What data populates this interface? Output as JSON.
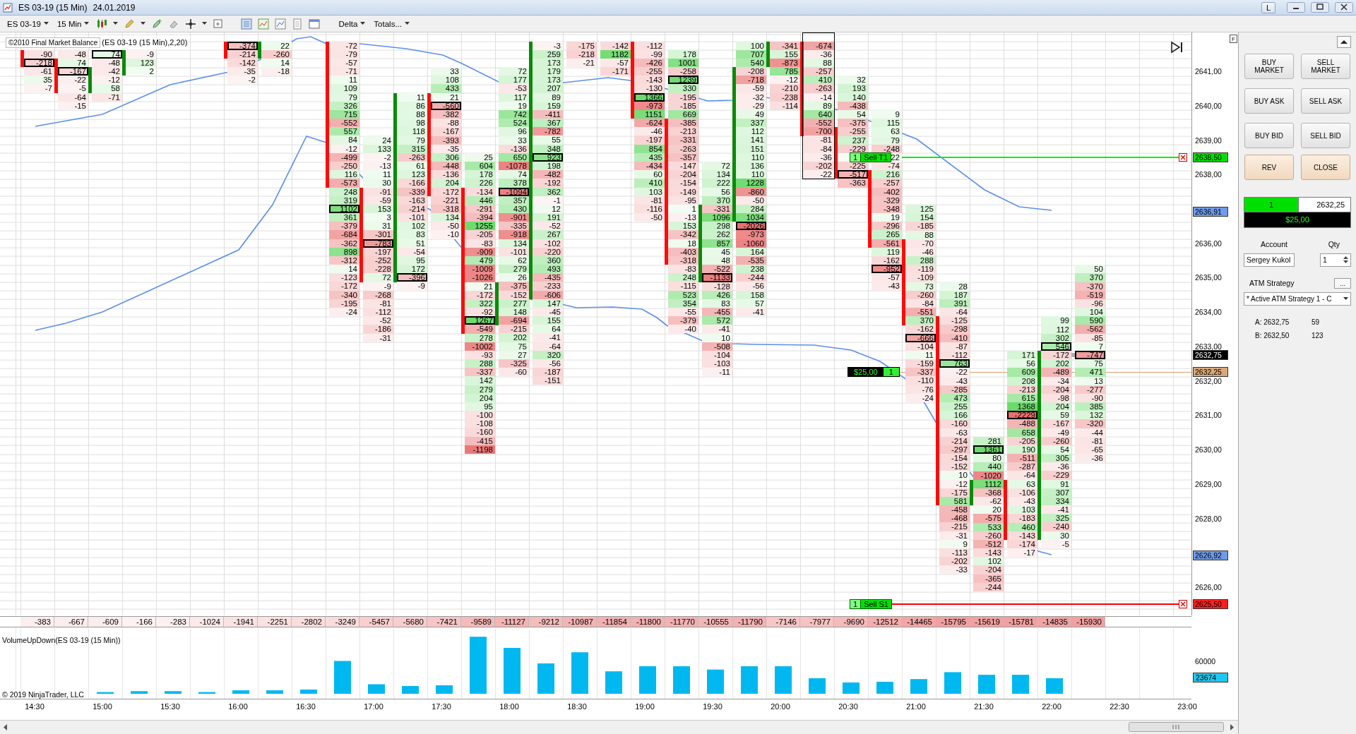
{
  "window": {
    "title": "ES 03-19 (15 Min)",
    "date": "24.01.2019",
    "corner_button": "L"
  },
  "toolbar": {
    "instrument": "ES 03-19",
    "interval": "15 Min",
    "menus": [
      "Delta",
      "Totals..."
    ]
  },
  "indicator_label": {
    "name": "©2010 Final Market Balance",
    "params": "(ES 03-19 (15 Min),2,20)"
  },
  "chart_corner_button": "F",
  "bars": [
    {
      "kind": "down",
      "outlined": false,
      "total": "-383",
      "cells_body": [
        "-90",
        {
          "value": "-218",
          "boxed": true
        }
      ],
      "cells_below": [
        "-61",
        "35",
        "-7"
      ]
    },
    {
      "kind": "down",
      "outlined": false,
      "total": "-667",
      "cells_above": [
        "-48"
      ],
      "cells_body": [
        "74",
        {
          "value": "-167",
          "boxed": true
        },
        "-22",
        "-5"
      ],
      "cells_below": [
        "-64",
        "-15"
      ]
    },
    {
      "kind": "up",
      "outlined": false,
      "total": "-609",
      "cells_above": [
        {
          "value": "74",
          "boxed": true
        },
        "-48"
      ],
      "cells_body": [
        "-42",
        "-12",
        "58"
      ],
      "cells_below": [
        "-71"
      ]
    },
    {
      "kind": "up",
      "outlined": false,
      "total": "-166",
      "cells_body": [
        "-9",
        "123",
        "2"
      ]
    },
    {
      "outlined": false,
      "total": "-283"
    },
    {
      "outlined": false,
      "total": "-1024"
    },
    {
      "kind": "down",
      "outlined": false,
      "total": "-1941",
      "cells_body": [
        {
          "value": "-374",
          "boxed": true
        },
        "-214"
      ],
      "cells_below": [
        "-142",
        "-35",
        "-2"
      ]
    },
    {
      "kind": "up",
      "outlined": false,
      "total": "-2251",
      "cells_body": [
        "22",
        "-260"
      ],
      "cells_below": [
        "14",
        "-18"
      ]
    },
    {
      "outlined": false,
      "total": "-2802"
    },
    {
      "kind": "down",
      "outlined": false,
      "total": "-3249",
      "cells_body": [
        "-72",
        "-79",
        "-57",
        "-71",
        "11",
        "109",
        "79",
        "326",
        "715",
        "-552",
        "557",
        "84",
        "-12",
        "-499",
        "-250",
        "116",
        "-573"
      ],
      "cells_below": [
        "248",
        "319",
        {
          "value": "1102",
          "boxed": true
        },
        "361",
        "-379",
        "-684",
        "-362",
        "898",
        "-312",
        "14",
        "-123",
        "-172",
        "-340",
        "-195",
        "-24"
      ]
    },
    {
      "kind": "down",
      "outlined": false,
      "total": "-5457",
      "cells_above": [
        "24",
        "133",
        "-2",
        "-13",
        "11",
        "30"
      ],
      "cells_body": [
        "-91",
        "-59",
        "153",
        "3",
        "31",
        "-301",
        {
          "value": "-783",
          "boxed": true
        },
        "-197",
        "-252",
        "-228",
        "72"
      ],
      "cells_below": [
        "-9",
        "-268",
        "-81",
        "-112",
        "-52",
        "-186",
        "-31"
      ]
    },
    {
      "kind": "up",
      "outlined": false,
      "total": "-5680",
      "cells_body": [
        "11",
        "86",
        "88",
        "98",
        "118",
        "79",
        "315",
        "-263",
        "61",
        "123",
        "-166",
        "-339",
        "-163",
        "-214",
        "-101",
        "102",
        "83",
        "51",
        "-54",
        "95",
        "172",
        {
          "value": "-396",
          "boxed": true
        }
      ],
      "cells_below": [
        "-9"
      ]
    },
    {
      "kind": "down",
      "outlined": false,
      "total": "-7421",
      "cells_above": [
        "33",
        "108",
        "433"
      ],
      "cells_body": [
        "21",
        {
          "value": "-560",
          "boxed": true
        },
        "-382",
        "-88",
        "-167",
        "-393",
        "-35",
        "306",
        "-448",
        "-136",
        "204",
        "-172"
      ],
      "cells_below": [
        "-221",
        "-318",
        "134",
        "-50",
        "-10"
      ]
    },
    {
      "kind": "down",
      "outlined": false,
      "total": "-9589",
      "cells_above": [
        "25",
        "604",
        "178",
        "226"
      ],
      "cells_body": [
        "-134",
        "446",
        "-291",
        "-394",
        "1255",
        "-205",
        "-83",
        "-909",
        "479",
        "-1009",
        "-1026",
        "21",
        "-172",
        "322",
        "-92",
        {
          "value": "1267",
          "boxed": true
        },
        "-549"
      ],
      "cells_below": [
        "278",
        "-1002",
        "-93",
        "288",
        "-337",
        "142",
        "279",
        "204",
        "95",
        "-100",
        "-108",
        "-160",
        "-415",
        "-1198"
      ]
    },
    {
      "kind": "up",
      "outlined": false,
      "total": "-11127",
      "cells_above": [
        "72",
        "177",
        "-53",
        "117",
        "19",
        "742",
        "524",
        "96",
        "33",
        "-136",
        "650",
        "-1078",
        "74",
        "378",
        {
          "value": "-1094",
          "boxed": true
        },
        "357",
        "430",
        "-901",
        "-335",
        "-918",
        "134",
        "-101",
        "62",
        "279",
        "26"
      ],
      "cells_body": [
        "-375",
        "-152",
        "277",
        "148",
        "-694"
      ],
      "cells_below": [
        "-215",
        "202",
        "75",
        "27",
        "-325",
        "-60"
      ]
    },
    {
      "kind": "up",
      "outlined": false,
      "total": "-9212",
      "cells_body": [
        "-3",
        "259",
        "173",
        "179",
        "173",
        "207",
        "89",
        "159",
        "-411",
        "367",
        "-782",
        "55",
        "348",
        {
          "value": "923",
          "boxed": true
        },
        "198",
        "-482",
        "-192",
        "362",
        "-1",
        "12",
        "191",
        "-52",
        "267",
        "-102",
        "-220",
        "360",
        "493",
        "-435",
        "-233",
        "-606"
      ],
      "cells_below": [
        "147",
        "-45",
        "155",
        "64",
        "-41",
        "-64",
        "320",
        "-56",
        "-187",
        "-151"
      ]
    },
    {
      "outlined": false,
      "total": "-10987",
      "cells": [
        "-175",
        "-218",
        "-21"
      ]
    },
    {
      "outlined": false,
      "total": "-11854",
      "cells": [
        "-142",
        "1182",
        "-57",
        "-171"
      ]
    },
    {
      "kind": "down",
      "outlined": false,
      "total": "-11800",
      "cells_body": [
        "-112",
        "-99",
        "-426",
        "-255",
        "-143",
        "-130",
        {
          "value": "1366",
          "boxed": true
        },
        "-973",
        "1151"
      ],
      "cells_below": [
        "-624",
        "-46",
        "-197",
        "854",
        "435",
        "-434",
        "60",
        "410",
        "103",
        "-81",
        "-116",
        "-50"
      ]
    },
    {
      "kind": "down",
      "outlined": false,
      "total": "-11770",
      "cells_above": [
        "178",
        "1001",
        "-258",
        {
          "value": "1239",
          "boxed": true
        },
        "330",
        "-195",
        "-185",
        "669"
      ],
      "cells_body": [
        "-385",
        "-213",
        "-331",
        "-263",
        "-357",
        "-147",
        "-204",
        "-154",
        "-149",
        "-95",
        "1",
        "-13",
        "153",
        "-342",
        "18",
        "-403",
        "-318"
      ],
      "cells_below": [
        "-83",
        "248",
        "-115",
        "523",
        "354",
        "-55",
        "-379",
        "-40"
      ]
    },
    {
      "kind": "up",
      "outlined": false,
      "total": "-10555",
      "cells_above": [
        "72",
        "134",
        "222",
        "56",
        "370"
      ],
      "cells_body": [
        "-331",
        "1096",
        "298",
        "262",
        "857",
        "45",
        "48",
        "-522",
        {
          "value": "-1133",
          "boxed": true
        }
      ],
      "cells_below": [
        "-128",
        "426",
        "83",
        "-455",
        "572",
        "-41",
        "10",
        "-508",
        "-104",
        "-103",
        "-11"
      ]
    },
    {
      "kind": "up",
      "outlined": false,
      "total": "-11790",
      "cells_above": [
        "100",
        "707",
        "540"
      ],
      "cells_body": [
        "-208",
        "-718",
        "-59",
        "-32",
        "-29",
        "49",
        "337",
        "112",
        "141",
        "151",
        "110",
        "136",
        "110",
        "1228",
        "-860",
        "-50",
        "284",
        "1034"
      ],
      "cells_below": [
        {
          "value": "-2026",
          "boxed": true
        },
        "-973",
        "-1060",
        "164",
        "-535",
        "238",
        "-244",
        "-56",
        "158",
        "57",
        "-41"
      ]
    },
    {
      "kind": "up",
      "outlined": false,
      "total": "-7146",
      "cells_body": [
        "-341",
        "155",
        "-873"
      ],
      "cells_below": [
        "785",
        "-12",
        "-210",
        "-238",
        "-114"
      ]
    },
    {
      "kind": "down",
      "outlined": true,
      "total": "-7977",
      "cells_body": [
        "-674",
        "-36",
        "88",
        "-257",
        "410",
        "-263",
        "-14",
        "89",
        "640",
        "-552",
        "-700"
      ],
      "cells_below": [
        "-81",
        "-84",
        "-36",
        "-202",
        "-22"
      ]
    },
    {
      "kind": "down",
      "outlined": false,
      "total": "-9690",
      "cells_above": [
        "32",
        "193",
        "140",
        "-438",
        "54",
        "-375"
      ],
      "cells_body": [
        "-255",
        "237",
        "-229",
        {
          "boxed": false
        },
        "-225",
        {
          "value": "-517",
          "boxed": true
        }
      ],
      "cells_below": [
        "-363"
      ]
    },
    {
      "kind": "down",
      "outlined": false,
      "total": "-12512",
      "cells_above": [
        "9",
        "115",
        "63",
        "79",
        "-248",
        "22",
        "-74"
      ],
      "cells_body": [
        "216",
        "-257",
        "-402",
        "-329",
        "-348",
        "19",
        "-296",
        "265",
        "-561"
      ],
      "cells_below": [
        "119",
        "-162",
        {
          "value": "-952",
          "boxed": true
        },
        "-57",
        "-43"
      ]
    },
    {
      "kind": "down",
      "outlined": false,
      "total": "-14465",
      "cells_above": [
        "125",
        "154",
        "-185",
        "88"
      ],
      "cells_body": [
        "-70",
        "-46",
        "288",
        "-119",
        "-109",
        "73",
        "-260",
        "-84",
        "-551",
        "370"
      ],
      "cells_below": [
        "-162",
        {
          "value": "-666",
          "boxed": true
        },
        "-104",
        "11",
        "-159",
        "-337",
        "-110",
        "-76",
        "-24"
      ]
    },
    {
      "kind": "down",
      "outlined": false,
      "total": "-15795",
      "cells_above": [
        "28",
        "187",
        "391",
        "-64"
      ],
      "cells_body": [
        "-125",
        "-298",
        "-410",
        "-87",
        "-112",
        {
          "value": "763",
          "boxed": true
        },
        "-22",
        "-43",
        "-285",
        "473",
        "255",
        "166",
        "-160",
        "-63",
        "-214",
        "-297",
        "-154",
        "-152",
        "10",
        "-12",
        "-175",
        "581"
      ],
      "cells_below": [
        "-458",
        "-468",
        "-215",
        "-31",
        "9",
        "-113",
        "-202",
        "-33"
      ]
    },
    {
      "kind": "up",
      "outlined": false,
      "total": "-15619",
      "cells_above": [
        "281",
        {
          "value": "1361",
          "boxed": true
        },
        "80",
        "440",
        "-1020"
      ],
      "cells_body": [
        "1112",
        "-368",
        "-62"
      ],
      "cells_below": [
        "20",
        "-575",
        "533",
        "-260",
        "-512",
        "-143",
        "102",
        "-204",
        "-365",
        "-244"
      ]
    },
    {
      "kind": "down",
      "outlined": false,
      "total": "-15781",
      "cells_above": [
        "171",
        "56",
        "609",
        "208",
        "-213",
        "615",
        "1368",
        {
          "value": "-2229",
          "boxed": true
        },
        "-488",
        "658",
        "-205",
        "190",
        "-511",
        "-287",
        "-64"
      ],
      "cells_body": [
        "63",
        "-106",
        "-43",
        "103",
        "-183",
        "460",
        "-143"
      ],
      "cells_below": [
        "-174",
        "-17"
      ]
    },
    {
      "kind": "up",
      "outlined": false,
      "total": "-14835",
      "cells_above": [
        "99",
        "112",
        "302",
        {
          "value": "546",
          "boxed": true
        }
      ],
      "cells_body": [
        "-172",
        "202",
        "-489",
        "-34",
        "-204",
        "-98",
        "204",
        "59",
        "-167",
        "-49",
        "-260",
        "54",
        "305",
        "-36",
        "-229",
        "91",
        "307",
        "334",
        "-41",
        "325",
        "-240",
        "30"
      ],
      "cells_below": [
        "-5"
      ]
    },
    {
      "kind": "flat",
      "outlined": false,
      "total": "-15930",
      "cells_above": [
        "50",
        "370",
        "-370",
        "-519",
        "-96",
        "104",
        "590",
        "-562",
        "-85",
        "7"
      ],
      "cells_body": [
        {
          "value": "-747",
          "boxed": true
        }
      ],
      "cells_below": [
        "75",
        "471",
        "13",
        "-277",
        "-90",
        "385",
        "132",
        "-320",
        "-44",
        "-81",
        "-65",
        "-36"
      ]
    }
  ],
  "price_axis": {
    "ticks": [
      "2641,00",
      "2640,00",
      "2639,00",
      "2638,00",
      "2636,00",
      "2635,00",
      "2634,00",
      "2633,00",
      "2632,00",
      "2631,00",
      "2630,00",
      "2629,00",
      "2628,00",
      "2626,00"
    ],
    "tags": [
      {
        "text": "2638,50",
        "color": "#00e000",
        "order": {
          "qty": "1",
          "label": "Sell T1",
          "color": "#00ee00"
        }
      },
      {
        "text": "2636,91",
        "color": "#6f9be8"
      },
      {
        "text": "2632,75",
        "color": "#000000"
      },
      {
        "text": "2632,25",
        "color": "#d8a878",
        "position": {
          "pnl": "$25,00",
          "qty": "1"
        }
      },
      {
        "text": "2626,92",
        "color": "#6f9be8"
      },
      {
        "text": "2625,50",
        "color": "#ff2020",
        "order": {
          "qty": "1",
          "label": "Sell S1",
          "color": "#ff0000"
        }
      }
    ]
  },
  "volume_panel": {
    "title": "VolumeUpDown(ES 03-19 (15 Min))",
    "axis_label": "60000",
    "value_tag": "23674",
    "copyright": "© 2019 NinjaTrader, LLC"
  },
  "time_axis": [
    "14:30",
    "15:00",
    "15:30",
    "16:00",
    "16:30",
    "17:00",
    "17:30",
    "18:00",
    "18:30",
    "19:00",
    "19:30",
    "20:00",
    "20:30",
    "21:00",
    "21:30",
    "22:00",
    "22:30",
    "23:00"
  ],
  "chart_trader": {
    "buttons": [
      {
        "label": "BUY MARKET",
        "kind": "order"
      },
      {
        "label": "SELL MARKET",
        "kind": "order"
      },
      {
        "label": "BUY ASK",
        "kind": "order"
      },
      {
        "label": "SELL ASK",
        "kind": "order"
      },
      {
        "label": "BUY BID",
        "kind": "order"
      },
      {
        "label": "SELL BID",
        "kind": "order"
      },
      {
        "label": "REV",
        "kind": "action"
      },
      {
        "label": "CLOSE",
        "kind": "action"
      }
    ],
    "position": {
      "qty": "1",
      "avg_price": "2632,25",
      "pnl": "$25,00"
    },
    "account_label": "Account",
    "qty_label": "Qty",
    "account": "Sergey Kukol",
    "qty": "1",
    "atm_label": "ATM Strategy",
    "atm_button": "...",
    "atm": "* Active ATM Strategy 1 - C",
    "ask": {
      "label": "A: 2632,75",
      "size": "59"
    },
    "bid": {
      "label": "B: 2632,50",
      "size": "123"
    }
  }
}
